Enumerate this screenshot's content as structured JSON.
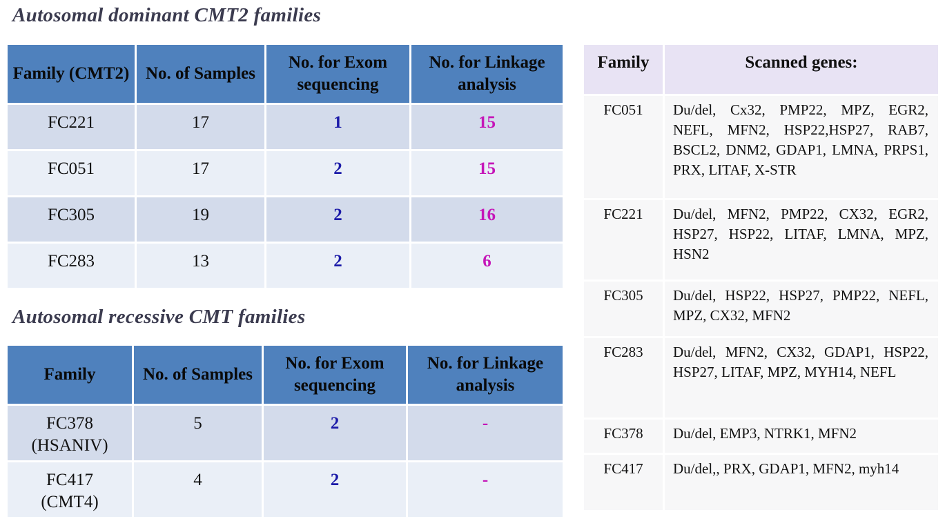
{
  "dominant": {
    "title": "Autosomal dominant CMT2 families",
    "headers": [
      "Family (CMT2)",
      "No. of Samples",
      "No. for Exom sequencing",
      "No. for Linkage analysis"
    ],
    "rows": [
      {
        "family": "FC221",
        "samples": "17",
        "exom": "1",
        "linkage": "15"
      },
      {
        "family": "FC051",
        "samples": "17",
        "exom": "2",
        "linkage": "15"
      },
      {
        "family": "FC305",
        "samples": "19",
        "exom": "2",
        "linkage": "16"
      },
      {
        "family": "FC283",
        "samples": "13",
        "exom": "2",
        "linkage": "6"
      }
    ]
  },
  "recessive": {
    "title": "Autosomal recessive CMT families",
    "headers": [
      "Family",
      "No. of Samples",
      "No. for Exom sequencing",
      "No. for Linkage analysis"
    ],
    "rows": [
      {
        "family": "FC378",
        "subtype": "(HSANIV)",
        "samples": "5",
        "exom": "2",
        "linkage": "-"
      },
      {
        "family": "FC417",
        "subtype": "(CMT4)",
        "samples": "4",
        "exom": "2",
        "linkage": "-"
      }
    ]
  },
  "genes": {
    "headers": [
      "Family",
      "Scanned genes:"
    ],
    "rows": [
      {
        "family": "FC051",
        "genes": "Du/del, Cx32, PMP22, MPZ, EGR2, NEFL, MFN2, HSP22,HSP27, RAB7, BSCL2, DNM2, GDAP1, LMNA, PRPS1, PRX, LITAF, X-STR"
      },
      {
        "family": "FC221",
        "genes": "Du/del, MFN2, PMP22, CX32, EGR2, HSP27, HSP22, LITAF, LMNA, MPZ, HSN2"
      },
      {
        "family": "FC305",
        "genes": "Du/del, HSP22, HSP27, PMP22, NEFL, MPZ, CX32, MFN2"
      },
      {
        "family": "FC283",
        "genes": "Du/del, MFN2, CX32, GDAP1, HSP22, HSP27, LITAF, MPZ, MYH14, NEFL"
      },
      {
        "family": "FC378",
        "genes": "Du/del, EMP3, NTRK1, MFN2"
      },
      {
        "family": "FC417",
        "genes": "Du/del,, PRX, GDAP1, MFN2, myh14"
      }
    ]
  },
  "colors": {
    "header_blue": "#4f81bd",
    "exom_blue": "#1b1aa8",
    "linkage_magenta": "#c516b8"
  }
}
